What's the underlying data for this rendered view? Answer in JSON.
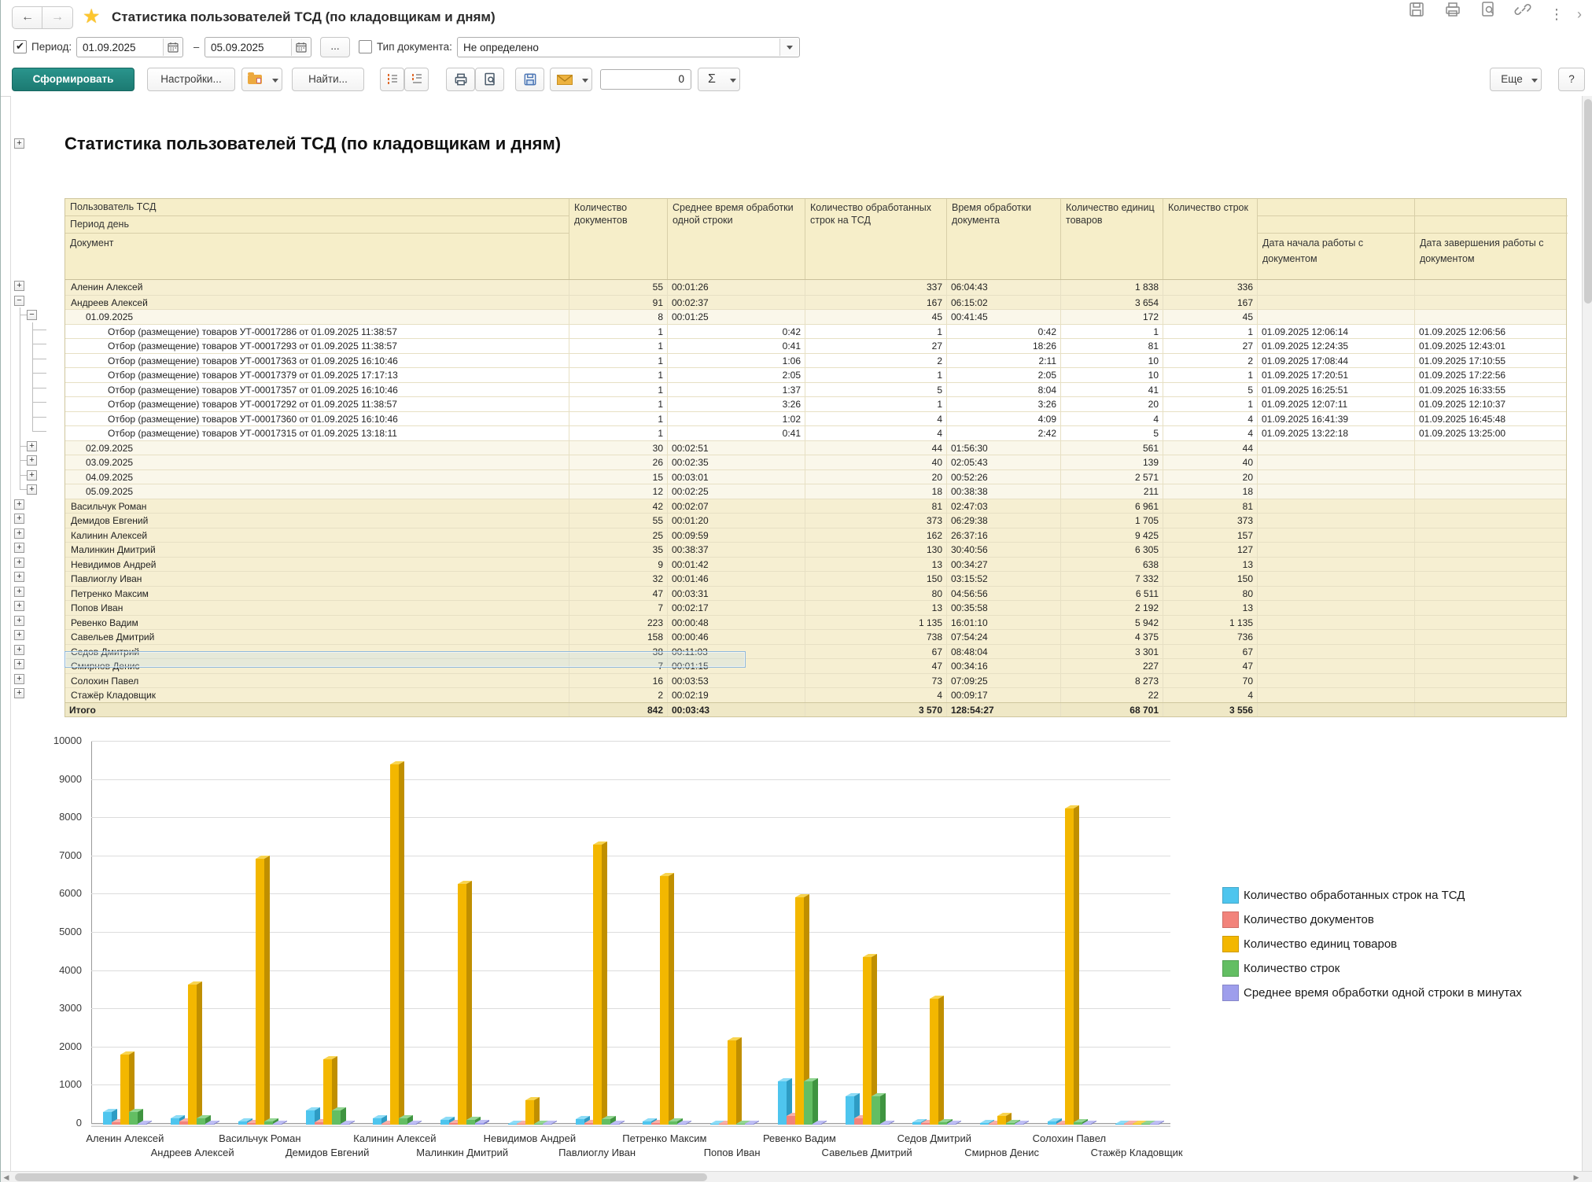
{
  "accent_color": "#1c7a72",
  "window": {
    "title": "Статистика пользователей ТСД (по кладовщикам и дням)",
    "back_arrow": "←",
    "forward_arrow": "→",
    "star": "★",
    "kebab": "⋮",
    "chevron": "›"
  },
  "filter": {
    "period_label": "Период:",
    "period_from": "01.09.2025",
    "period_to": "05.09.2025",
    "range_dash": "–",
    "more_btn": "...",
    "doctype_label": "Тип документа:",
    "doctype_value": "Не определено"
  },
  "toolbar": {
    "generate": "Сформировать",
    "settings": "Настройки...",
    "find": "Найти...",
    "counter": "0",
    "sigma": "Σ",
    "more": "Еще",
    "help": "?"
  },
  "report": {
    "title": "Статистика пользователей ТСД (по кладовщикам и дням)",
    "table": {
      "headers": {
        "h_user": "Пользователь ТСД",
        "h_period": "Период день",
        "h_doc": "Документ",
        "h_docs": "Количество документов",
        "h_avg": "Среднее время обработки одной строки",
        "h_rows": "Количество обработанных строк на ТСД",
        "h_time": "Время обработки документа",
        "h_units": "Количество единиц товаров",
        "h_lines": "Количество строк",
        "h_start": "Дата начала работы с документом",
        "h_end": "Дата завершения работы с документом"
      },
      "rows": [
        {
          "lvl": "user",
          "exp": "plus",
          "name": "Аленин Алексей",
          "docs": "55",
          "avg": "00:01:26",
          "rows": "337",
          "time": "06:04:43",
          "units": "1 838",
          "lines": "336",
          "start": "",
          "end": ""
        },
        {
          "lvl": "user",
          "exp": "minus",
          "name": "Андреев Алексей",
          "docs": "91",
          "avg": "00:02:37",
          "rows": "167",
          "time": "06:15:02",
          "units": "3 654",
          "lines": "167",
          "start": "",
          "end": ""
        },
        {
          "lvl": "date",
          "exp": "minus",
          "name": "01.09.2025",
          "docs": "8",
          "avg": "00:01:25",
          "rows": "45",
          "time": "00:41:45",
          "units": "172",
          "lines": "45",
          "start": "",
          "end": ""
        },
        {
          "lvl": "doc",
          "exp": null,
          "name": "Отбор (размещение) товаров УТ-00017286 от 01.09.2025 11:38:57",
          "docs": "1",
          "avg": "0:42",
          "rows": "1",
          "time": "0:42",
          "units": "1",
          "lines": "1",
          "start": "01.09.2025 12:06:14",
          "end": "01.09.2025 12:06:56"
        },
        {
          "lvl": "doc",
          "exp": null,
          "name": "Отбор (размещение) товаров УТ-00017293 от 01.09.2025 11:38:57",
          "docs": "1",
          "avg": "0:41",
          "rows": "27",
          "time": "18:26",
          "units": "81",
          "lines": "27",
          "start": "01.09.2025 12:24:35",
          "end": "01.09.2025 12:43:01"
        },
        {
          "lvl": "doc",
          "exp": null,
          "name": "Отбор (размещение) товаров УТ-00017363 от 01.09.2025 16:10:46",
          "docs": "1",
          "avg": "1:06",
          "rows": "2",
          "time": "2:11",
          "units": "10",
          "lines": "2",
          "start": "01.09.2025 17:08:44",
          "end": "01.09.2025 17:10:55"
        },
        {
          "lvl": "doc",
          "exp": null,
          "name": "Отбор (размещение) товаров УТ-00017379 от 01.09.2025 17:17:13",
          "docs": "1",
          "avg": "2:05",
          "rows": "1",
          "time": "2:05",
          "units": "10",
          "lines": "1",
          "start": "01.09.2025 17:20:51",
          "end": "01.09.2025 17:22:56"
        },
        {
          "lvl": "doc",
          "exp": null,
          "name": "Отбор (размещение) товаров УТ-00017357 от 01.09.2025 16:10:46",
          "docs": "1",
          "avg": "1:37",
          "rows": "5",
          "time": "8:04",
          "units": "41",
          "lines": "5",
          "start": "01.09.2025 16:25:51",
          "end": "01.09.2025 16:33:55"
        },
        {
          "lvl": "doc",
          "exp": null,
          "name": "Отбор (размещение) товаров УТ-00017292 от 01.09.2025 11:38:57",
          "docs": "1",
          "avg": "3:26",
          "rows": "1",
          "time": "3:26",
          "units": "20",
          "lines": "1",
          "start": "01.09.2025 12:07:11",
          "end": "01.09.2025 12:10:37"
        },
        {
          "lvl": "doc",
          "exp": null,
          "name": "Отбор (размещение) товаров УТ-00017360 от 01.09.2025 16:10:46",
          "docs": "1",
          "avg": "1:02",
          "rows": "4",
          "time": "4:09",
          "units": "4",
          "lines": "4",
          "start": "01.09.2025 16:41:39",
          "end": "01.09.2025 16:45:48"
        },
        {
          "lvl": "doc",
          "exp": null,
          "name": "Отбор (размещение) товаров УТ-00017315 от 01.09.2025 13:18:11",
          "docs": "1",
          "avg": "0:41",
          "rows": "4",
          "time": "2:42",
          "units": "5",
          "lines": "4",
          "start": "01.09.2025 13:22:18",
          "end": "01.09.2025 13:25:00"
        },
        {
          "lvl": "date",
          "exp": "plus",
          "name": "02.09.2025",
          "docs": "30",
          "avg": "00:02:51",
          "rows": "44",
          "time": "01:56:30",
          "units": "561",
          "lines": "44",
          "start": "",
          "end": ""
        },
        {
          "lvl": "date",
          "exp": "plus",
          "name": "03.09.2025",
          "docs": "26",
          "avg": "00:02:35",
          "rows": "40",
          "time": "02:05:43",
          "units": "139",
          "lines": "40",
          "start": "",
          "end": ""
        },
        {
          "lvl": "date",
          "exp": "plus",
          "name": "04.09.2025",
          "docs": "15",
          "avg": "00:03:01",
          "rows": "20",
          "time": "00:52:26",
          "units": "2 571",
          "lines": "20",
          "start": "",
          "end": ""
        },
        {
          "lvl": "date",
          "exp": "plus",
          "name": "05.09.2025",
          "docs": "12",
          "avg": "00:02:25",
          "rows": "18",
          "time": "00:38:38",
          "units": "211",
          "lines": "18",
          "start": "",
          "end": ""
        },
        {
          "lvl": "user",
          "exp": "plus",
          "name": "Васильчук Роман",
          "docs": "42",
          "avg": "00:02:07",
          "rows": "81",
          "time": "02:47:03",
          "units": "6 961",
          "lines": "81",
          "start": "",
          "end": ""
        },
        {
          "lvl": "user",
          "exp": "plus",
          "name": "Демидов Евгений",
          "docs": "55",
          "avg": "00:01:20",
          "rows": "373",
          "time": "06:29:38",
          "units": "1 705",
          "lines": "373",
          "start": "",
          "end": ""
        },
        {
          "lvl": "user",
          "exp": "plus",
          "name": "Калинин Алексей",
          "docs": "25",
          "avg": "00:09:59",
          "rows": "162",
          "time": "26:37:16",
          "units": "9 425",
          "lines": "157",
          "start": "",
          "end": ""
        },
        {
          "lvl": "user",
          "exp": "plus",
          "name": "Малинкин Дмитрий",
          "docs": "35",
          "avg": "00:38:37",
          "rows": "130",
          "time": "30:40:56",
          "units": "6 305",
          "lines": "127",
          "start": "",
          "end": ""
        },
        {
          "lvl": "user",
          "exp": "plus",
          "name": "Невидимов Андрей",
          "docs": "9",
          "avg": "00:01:42",
          "rows": "13",
          "time": "00:34:27",
          "units": "638",
          "lines": "13",
          "start": "",
          "end": ""
        },
        {
          "lvl": "user",
          "exp": "plus",
          "name": "Павлиоглу Иван",
          "docs": "32",
          "avg": "00:01:46",
          "rows": "150",
          "time": "03:15:52",
          "units": "7 332",
          "lines": "150",
          "start": "",
          "end": ""
        },
        {
          "lvl": "user",
          "exp": "plus",
          "name": "Петренко Максим",
          "docs": "47",
          "avg": "00:03:31",
          "rows": "80",
          "time": "04:56:56",
          "units": "6 511",
          "lines": "80",
          "start": "",
          "end": ""
        },
        {
          "lvl": "user",
          "exp": "plus",
          "name": "Попов Иван",
          "docs": "7",
          "avg": "00:02:17",
          "rows": "13",
          "time": "00:35:58",
          "units": "2 192",
          "lines": "13",
          "start": "",
          "end": ""
        },
        {
          "lvl": "user",
          "exp": "plus",
          "name": "Ревенко Вадим",
          "docs": "223",
          "avg": "00:00:48",
          "rows": "1 135",
          "time": "16:01:10",
          "units": "5 942",
          "lines": "1 135",
          "start": "",
          "end": ""
        },
        {
          "lvl": "user",
          "exp": "plus",
          "name": "Савельев Дмитрий",
          "docs": "158",
          "avg": "00:00:46",
          "rows": "738",
          "time": "07:54:24",
          "units": "4 375",
          "lines": "736",
          "start": "",
          "end": ""
        },
        {
          "lvl": "user",
          "exp": "plus",
          "name": "Седов Дмитрий",
          "docs": "38",
          "avg": "00:11:03",
          "rows": "67",
          "time": "08:48:04",
          "units": "3 301",
          "lines": "67",
          "start": "",
          "end": ""
        },
        {
          "lvl": "user",
          "exp": "plus",
          "name": "Смирнов Денис",
          "docs": "7",
          "avg": "00:01:15",
          "rows": "47",
          "time": "00:34:16",
          "units": "227",
          "lines": "47",
          "start": "",
          "end": ""
        },
        {
          "lvl": "user",
          "exp": "plus",
          "name": "Солохин Павел",
          "docs": "16",
          "avg": "00:03:53",
          "rows": "73",
          "time": "07:09:25",
          "units": "8 273",
          "lines": "70",
          "start": "",
          "end": ""
        },
        {
          "lvl": "user",
          "exp": "plus",
          "name": "Стажёр Кладовщик",
          "docs": "2",
          "avg": "00:02:19",
          "rows": "4",
          "time": "00:09:17",
          "units": "22",
          "lines": "4",
          "start": "",
          "end": ""
        },
        {
          "lvl": "total",
          "exp": null,
          "name": "Итого",
          "docs": "842",
          "avg": "00:03:43",
          "rows": "3 570",
          "time": "128:54:27",
          "units": "68 701",
          "lines": "3 556",
          "start": "",
          "end": ""
        }
      ]
    }
  },
  "chart_data": {
    "type": "bar",
    "style": "3d",
    "title": "",
    "xlabel": "",
    "ylabel": "",
    "ylim": [
      0,
      10000
    ],
    "yticks": [
      0,
      1000,
      2000,
      3000,
      4000,
      5000,
      6000,
      7000,
      8000,
      9000,
      10000
    ],
    "grid": true,
    "legend_position": "right",
    "categories": [
      "Аленин Алексей",
      "Андреев Алексей",
      "Васильчук Роман",
      "Демидов Евгений",
      "Калинин Алексей",
      "Малинкин Дмитрий",
      "Невидимов Андрей",
      "Павлиоглу Иван",
      "Петренко Максим",
      "Попов Иван",
      "Ревенко Вадим",
      "Савельев Дмитрий",
      "Седов Дмитрий",
      "Смирнов Денис",
      "Солохин Павел",
      "Стажёр Кладовщик"
    ],
    "series": [
      {
        "name": "Количество обработанных строк на ТСД",
        "color": "#4ec5ee",
        "top": "#8edcf6",
        "side": "#2e9cc4",
        "values": [
          337,
          167,
          81,
          373,
          162,
          130,
          13,
          150,
          80,
          13,
          1135,
          738,
          67,
          47,
          73,
          4
        ]
      },
      {
        "name": "Количество документов",
        "color": "#f2837b",
        "top": "#f8b0a8",
        "side": "#c75b55",
        "values": [
          55,
          91,
          42,
          55,
          25,
          35,
          9,
          32,
          47,
          7,
          223,
          158,
          38,
          7,
          16,
          2
        ]
      },
      {
        "name": "Количество единиц товаров",
        "color": "#f3b700",
        "top": "#f8d44f",
        "side": "#c08f00",
        "values": [
          1838,
          3654,
          6961,
          1705,
          9425,
          6305,
          638,
          7332,
          6511,
          2192,
          5942,
          4375,
          3301,
          227,
          8273,
          22
        ]
      },
      {
        "name": "Количество строк",
        "color": "#63be63",
        "top": "#93d693",
        "side": "#3f9440",
        "values": [
          336,
          167,
          81,
          373,
          157,
          127,
          13,
          150,
          80,
          13,
          1135,
          736,
          67,
          47,
          70,
          4
        ]
      },
      {
        "name": "Среднее время обработки одной строки в минутах",
        "color": "#9e9eec",
        "top": "#bfbff4",
        "side": "#7676c4",
        "values": [
          1.4,
          2.6,
          2.1,
          1.3,
          10,
          38.6,
          1.7,
          1.8,
          3.5,
          2.3,
          0.8,
          0.8,
          11,
          1.3,
          3.9,
          2.3
        ]
      }
    ]
  }
}
